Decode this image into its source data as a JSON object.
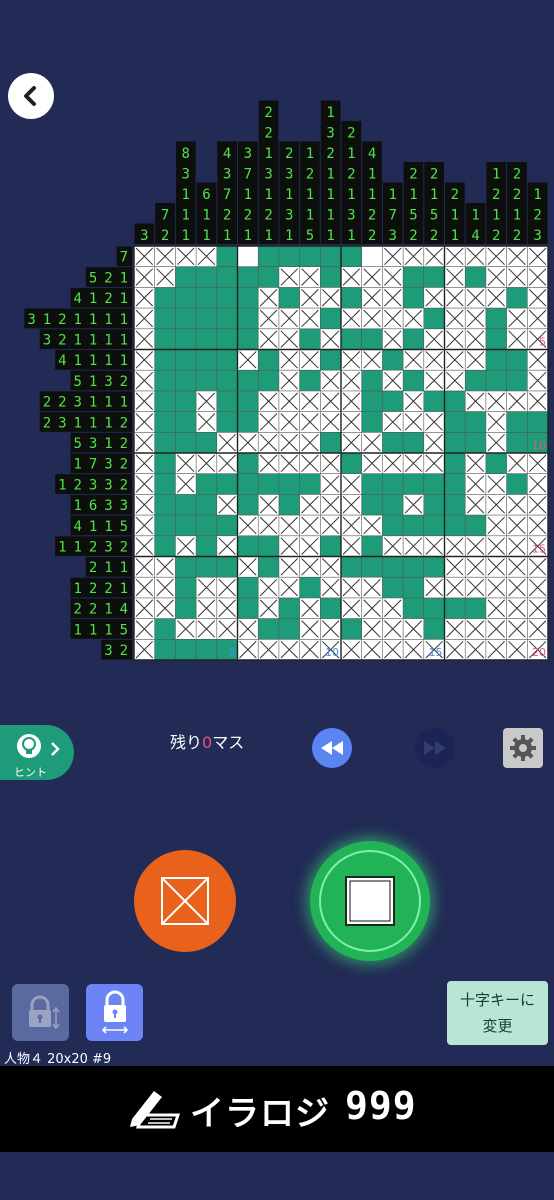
{
  "colors": {
    "background": "#222a56",
    "filled": "#1e9b78",
    "cross_bg": "#ffffff",
    "clue_text": "#4fe24b",
    "clue_bg": "#0d0f0d",
    "marker_red": "#e8527f",
    "marker_blue": "#4a8cf0"
  },
  "column_clues": [
    [
      "3"
    ],
    [
      "7",
      "2"
    ],
    [
      "8",
      "3",
      "1",
      "1",
      "1"
    ],
    [
      "6",
      "1",
      "1"
    ],
    [
      "4",
      "3",
      "7",
      "2",
      "1"
    ],
    [
      "3",
      "7",
      "1",
      "2",
      "1"
    ],
    [
      "2",
      "2",
      "1",
      "3",
      "1",
      "2",
      "1"
    ],
    [
      "2",
      "3",
      "1",
      "3",
      "1"
    ],
    [
      "1",
      "2",
      "1",
      "1",
      "5"
    ],
    [
      "1",
      "3",
      "2",
      "1",
      "1",
      "1",
      "1"
    ],
    [
      "2",
      "1",
      "2",
      "1",
      "3",
      "1"
    ],
    [
      "4",
      "1",
      "1",
      "2",
      "2"
    ],
    [
      "1",
      "7",
      "3"
    ],
    [
      "2",
      "1",
      "5",
      "2"
    ],
    [
      "2",
      "1",
      "5",
      "2"
    ],
    [
      "2",
      "1",
      "1"
    ],
    [
      "1",
      "4"
    ],
    [
      "1",
      "2",
      "1",
      "2"
    ],
    [
      "2",
      "2",
      "1",
      "2"
    ],
    [
      "1",
      "2",
      "3"
    ]
  ],
  "row_clues": [
    [
      "7"
    ],
    [
      "5",
      "2",
      "1"
    ],
    [
      "4",
      "1",
      "2",
      "1"
    ],
    [
      "3",
      "1",
      "2",
      "1",
      "1",
      "1",
      "1"
    ],
    [
      "3",
      "2",
      "1",
      "1",
      "1",
      "1"
    ],
    [
      "4",
      "1",
      "1",
      "1",
      "1"
    ],
    [
      "5",
      "1",
      "3",
      "2"
    ],
    [
      "2",
      "2",
      "3",
      "1",
      "1",
      "1"
    ],
    [
      "2",
      "3",
      "1",
      "1",
      "1",
      "2"
    ],
    [
      "5",
      "3",
      "1",
      "2"
    ],
    [
      "1",
      "7",
      "3",
      "2"
    ],
    [
      "1",
      "2",
      "3",
      "3",
      "2"
    ],
    [
      "1",
      "6",
      "3",
      "3"
    ],
    [
      "4",
      "1",
      "1",
      "5"
    ],
    [
      "1",
      "1",
      "2",
      "3",
      "2"
    ],
    [
      "2",
      "1",
      "1"
    ],
    [
      "1",
      "2",
      "2",
      "1"
    ],
    [
      "2",
      "2",
      "1",
      "4"
    ],
    [
      "1",
      "1",
      "1",
      "5"
    ],
    [
      "3",
      "2"
    ]
  ],
  "grid_rows": [
    "xxxxf.fffff.xxxxxxxx",
    "xxfffffxxfxxxffxfxxx",
    "xfffffxfxxfxxfxxxxfx",
    "xfffffxxxfxxxxfxxfxx",
    "xfffffxxfxffxfxxxfxx",
    "xffffxfxxfxxfxxxxffx",
    "xffffffxfxxfxfxxfffx",
    "xffxffxxxxxffxffxxxx",
    "xffxffxxxxxfxxxffxff",
    "xfffxxxxxfxxffxffxff",
    "xfxxxfxxxxfxxxxfxfxx",
    "xfxffffffxxfffffxxfx",
    "xfffxfxfxxxffxffxxxx",
    "xffffxxxxxxxfffffxxx",
    "xfxfxffxxfxfxxxxxxxx",
    "xxfffxfxxxfffffxxxxx",
    "xxfxxfxxfxxxffxxxxxx",
    "xxfxxfxfxfxxxffffxxx",
    "xfxxxxffxxfxxxfxxxxx",
    "xffffxxxxxxxxxxxxxxx"
  ],
  "grid_size": "20x20",
  "row_markers": [
    {
      "row": 5,
      "label": "5"
    },
    {
      "row": 10,
      "label": "10"
    },
    {
      "row": 15,
      "label": "15"
    },
    {
      "row": 20,
      "label": "20"
    }
  ],
  "col_markers": [
    {
      "col": 5,
      "label": "5"
    },
    {
      "col": 10,
      "label": "10"
    },
    {
      "col": 15,
      "label": "15"
    }
  ],
  "hint": {
    "label": "ヒント"
  },
  "remaining": {
    "prefix": "残り",
    "count": "0",
    "suffix": "マス"
  },
  "dpad_button": {
    "line1": "十字キーに",
    "line2": "変更"
  },
  "puzzle_info": "人物４ 20x20 #9",
  "footer": {
    "title": "イラロジ",
    "number": "999"
  },
  "icons": [
    "back-icon",
    "lightbulb-icon",
    "rewind-icon",
    "fast-forward-icon",
    "gear-icon",
    "cross-mode-icon",
    "fill-mode-icon",
    "lock-vertical-icon",
    "lock-horizontal-icon",
    "pencil-logo-icon"
  ]
}
